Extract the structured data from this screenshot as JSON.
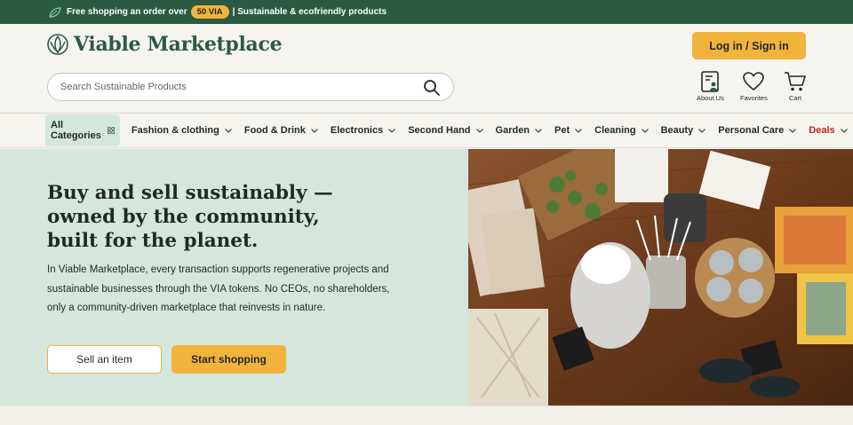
{
  "topbar": {
    "text_before": "Free shopping an order over",
    "pill": "50 VIA",
    "text_after": "| Sustainable & ecofriendly products"
  },
  "header": {
    "logo_text": "Viable Marketplace",
    "login_label": "Log in / Sign in",
    "search_placeholder": "Search Sustainable Products",
    "icons": {
      "about": "About Us",
      "favorites": "Favorites",
      "cart": "Cart"
    }
  },
  "nav": {
    "all_categories": "All Categories",
    "items": [
      "Fashion & clothing",
      "Food & Drink",
      "Electronics",
      "Second Hand",
      "Garden",
      "Pet",
      "Cleaning",
      "Beauty",
      "Personal Care"
    ],
    "deals": "Deals"
  },
  "hero": {
    "title": "Buy and sell sustainably — owned by the community, built for the planet.",
    "body": "In Viable Marketplace, every transaction supports regenerative projects and sustainable businesses through the VIA tokens. No CEOs, no shareholders, only a community-driven marketplace that reinvests in nature.",
    "sell_label": "Sell an item",
    "shop_label": "Start shopping"
  },
  "colors": {
    "brand_green": "#2b5a43",
    "accent_yellow": "#f2b33d",
    "hero_bg": "#d5e6dd",
    "deals_red": "#c8261f"
  }
}
